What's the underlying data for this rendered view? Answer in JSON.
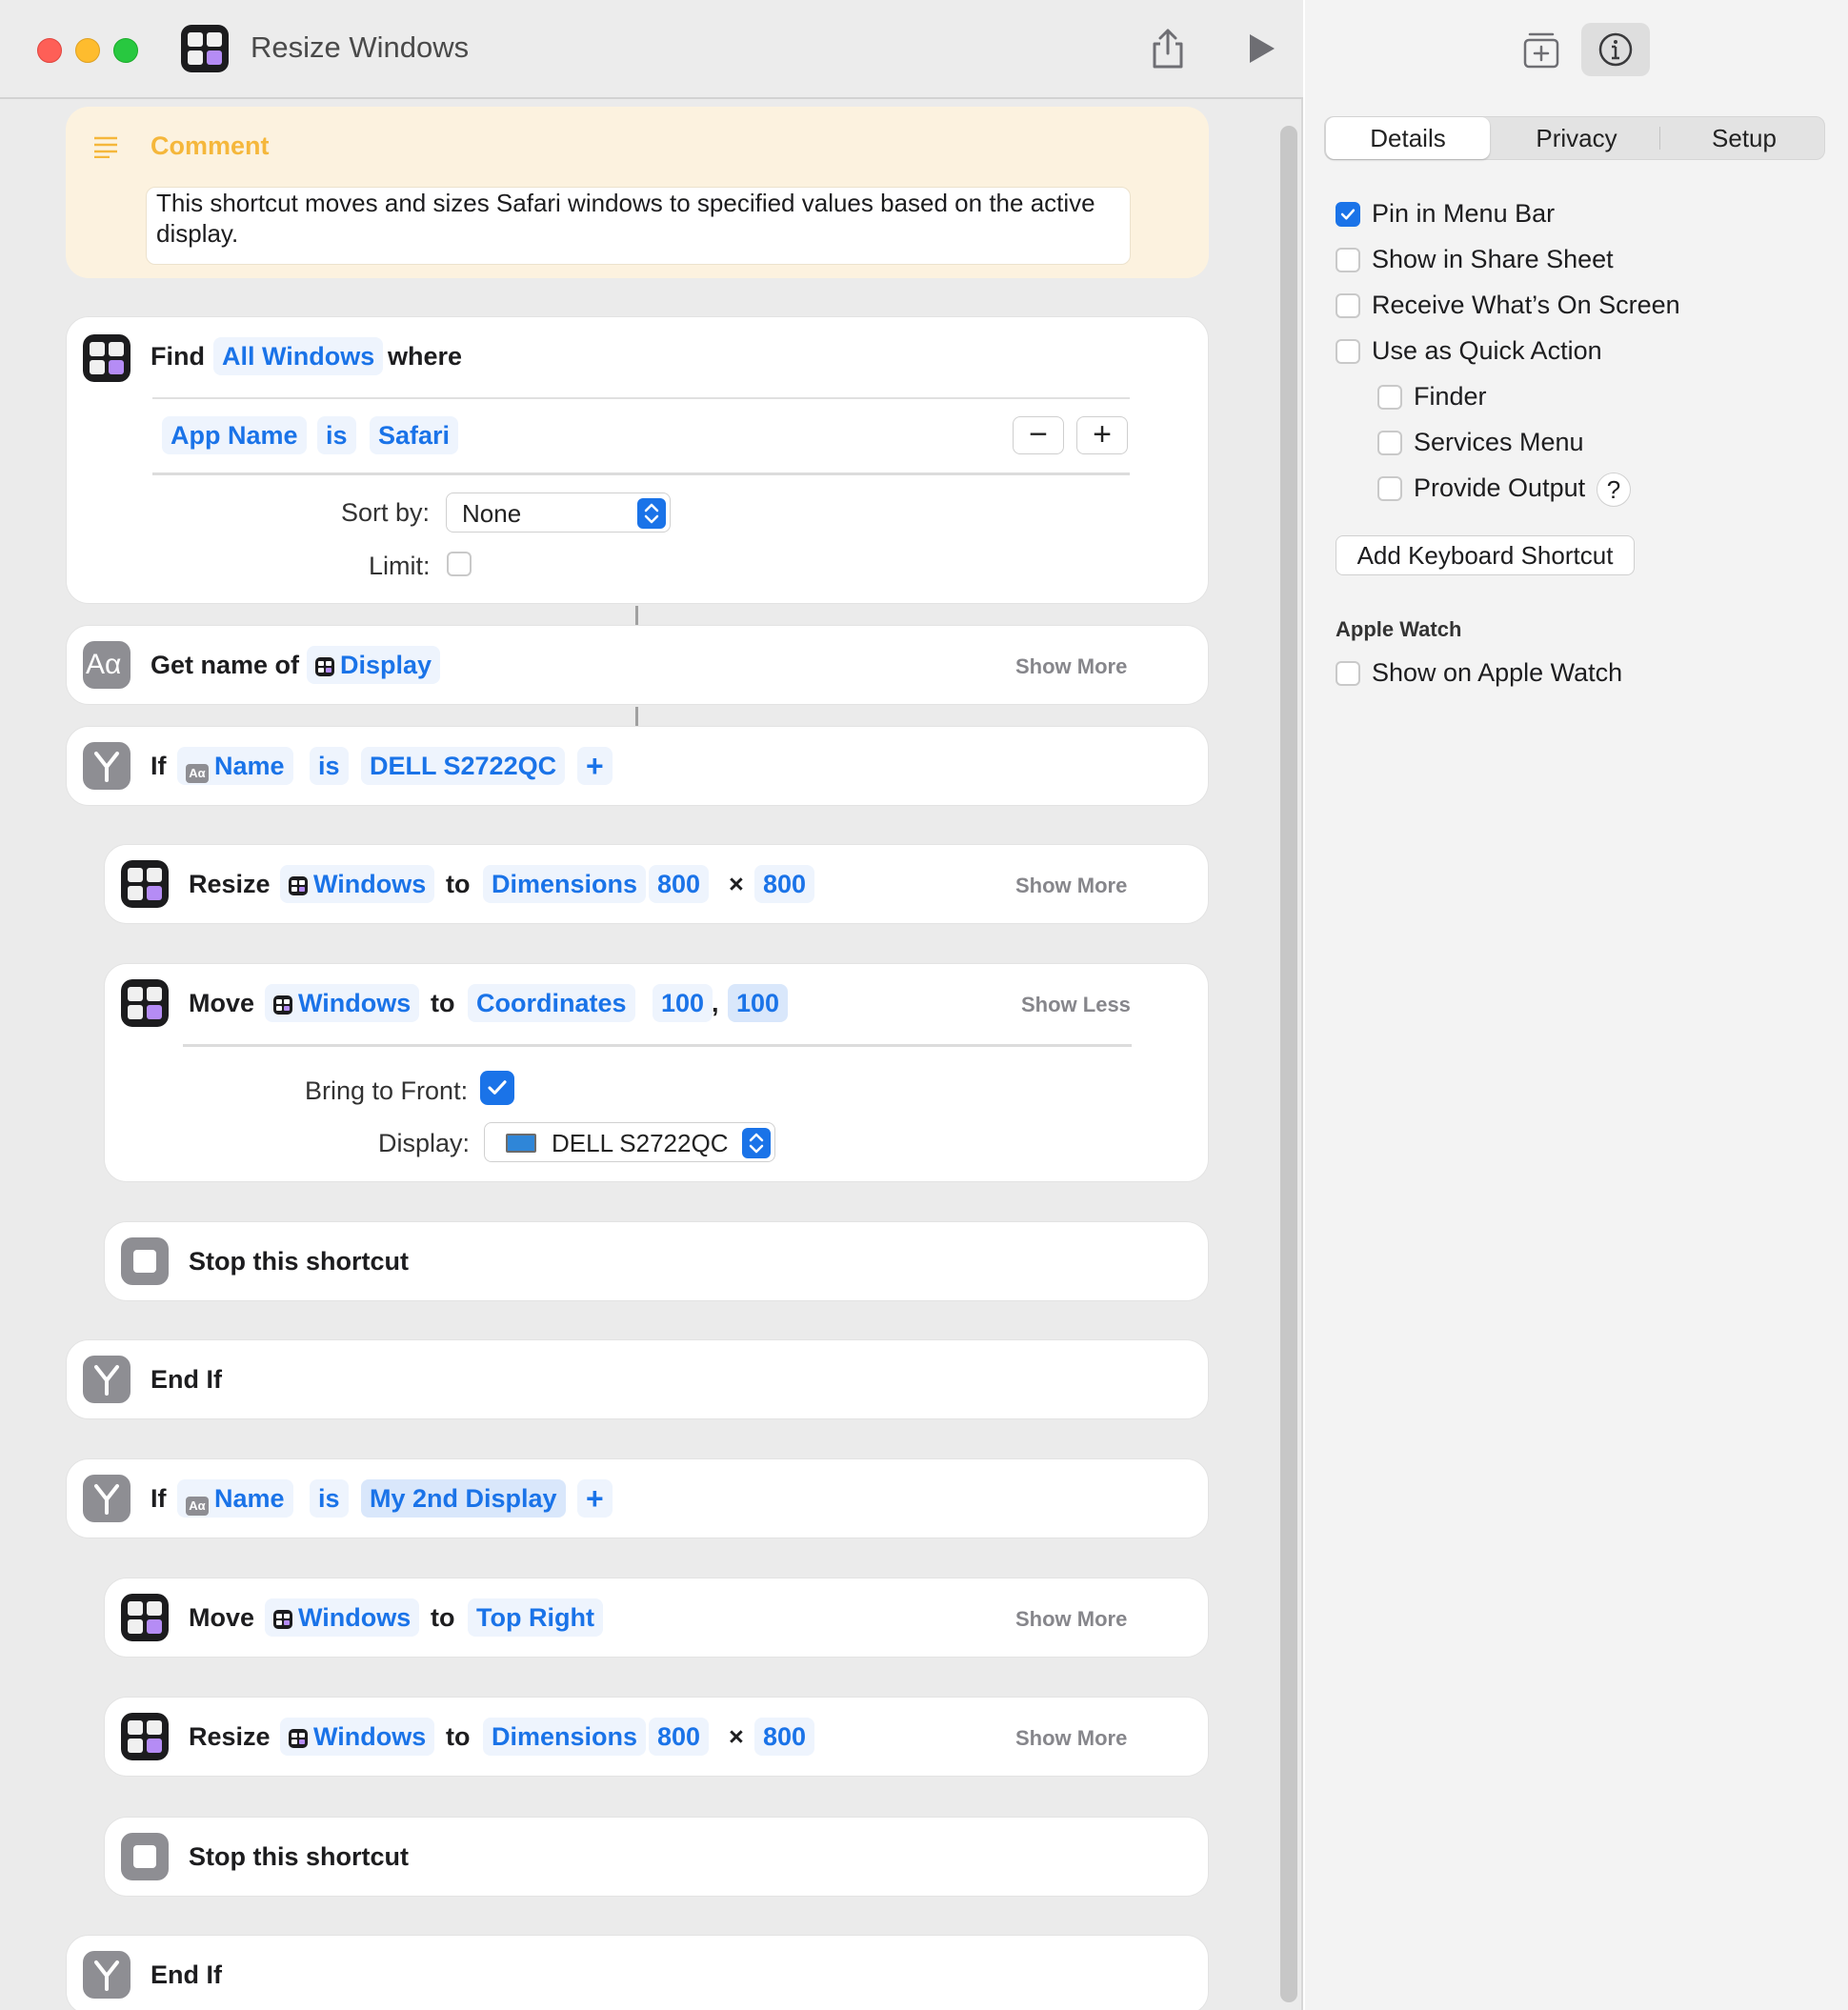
{
  "window": {
    "title": "Resize Windows"
  },
  "comment": {
    "title": "Comment",
    "text": "This shortcut moves and sizes Safari windows to specified values based on the active display."
  },
  "find": {
    "verb": "Find",
    "target": "All Windows",
    "where": "where",
    "filter": {
      "field": "App Name",
      "op": "is",
      "value": "Safari"
    },
    "sort_label": "Sort by:",
    "sort_value": "None",
    "limit_label": "Limit:",
    "limit_checked": false
  },
  "get_name": {
    "label": "Get name of",
    "target": "Display",
    "more": "Show More"
  },
  "if1": {
    "label": "If",
    "var": "Name",
    "op": "is",
    "value": "DELL S2722QC",
    "add": "+"
  },
  "resize1": {
    "verb": "Resize",
    "target": "Windows",
    "to": "to",
    "mode": "Dimensions",
    "w": "800",
    "x": "×",
    "h": "800",
    "more": "Show More"
  },
  "move1": {
    "verb": "Move",
    "target": "Windows",
    "to": "to",
    "mode": "Coordinates",
    "x": "100",
    "comma": ",",
    "y": "100",
    "more": "Show Less",
    "front_label": "Bring to Front:",
    "front_checked": true,
    "display_label": "Display:",
    "display_value": "DELL S2722QC"
  },
  "stop1": {
    "label": "Stop this shortcut"
  },
  "endif1": {
    "label": "End If"
  },
  "if2": {
    "label": "If",
    "var": "Name",
    "op": "is",
    "value": "My 2nd Display",
    "add": "+"
  },
  "move2": {
    "verb": "Move",
    "target": "Windows",
    "to": "to",
    "pos": "Top Right",
    "more": "Show More"
  },
  "resize2": {
    "verb": "Resize",
    "target": "Windows",
    "to": "to",
    "mode": "Dimensions",
    "w": "800",
    "x": "×",
    "h": "800",
    "more": "Show More"
  },
  "stop2": {
    "label": "Stop this shortcut"
  },
  "endif2": {
    "label": "End If"
  },
  "sidebar": {
    "tabs": [
      "Details",
      "Privacy",
      "Setup"
    ],
    "active_tab": "Details",
    "options": [
      {
        "label": "Pin in Menu Bar",
        "checked": true
      },
      {
        "label": "Show in Share Sheet",
        "checked": false
      },
      {
        "label": "Receive What’s On Screen",
        "checked": false
      },
      {
        "label": "Use as Quick Action",
        "checked": false
      },
      {
        "label": "Finder",
        "checked": false
      },
      {
        "label": "Services Menu",
        "checked": false
      },
      {
        "label": "Provide Output",
        "checked": false
      }
    ],
    "help": "?",
    "keyboard_button": "Add Keyboard Shortcut",
    "apple_watch_heading": "Apple Watch",
    "apple_watch_option": {
      "label": "Show on Apple Watch",
      "checked": false
    }
  },
  "colors": {
    "accent": "#1a73e8",
    "comment_bg": "#fcf2df",
    "comment_title": "#f5b73b"
  }
}
